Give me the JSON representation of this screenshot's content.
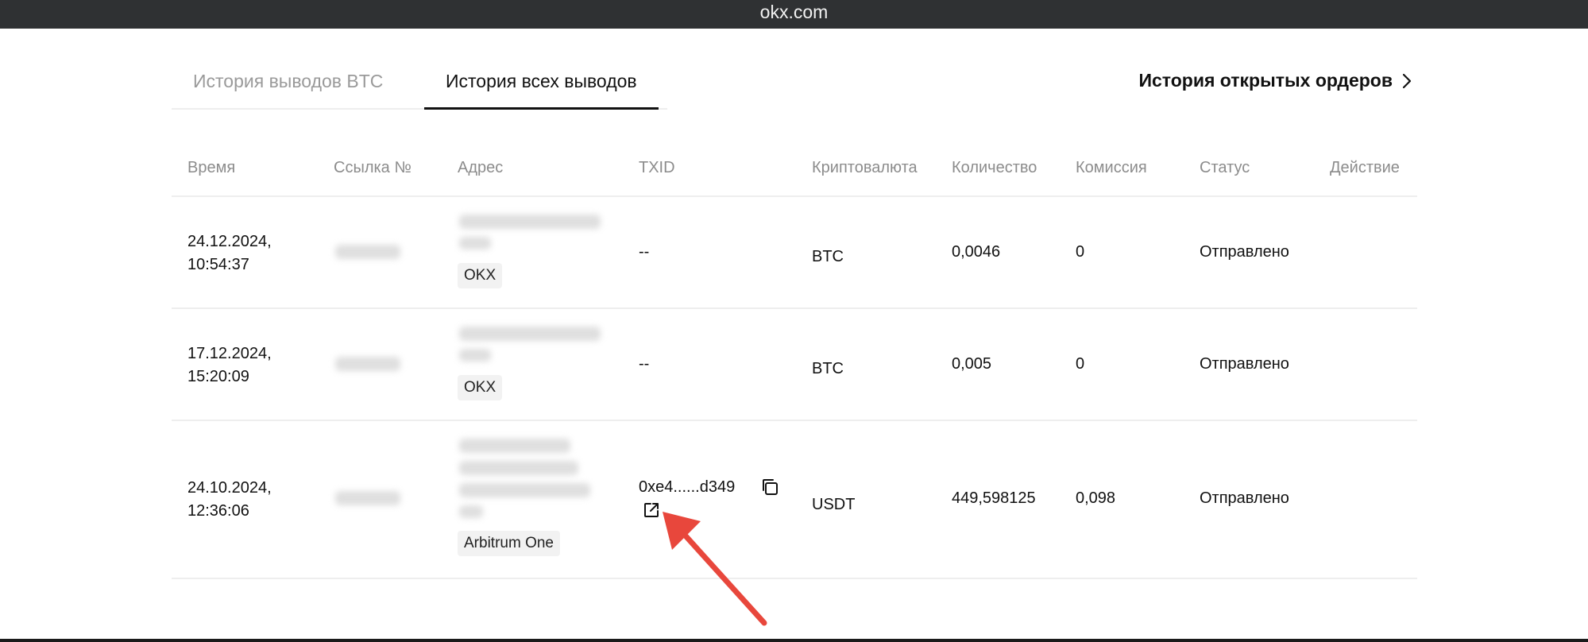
{
  "browser": {
    "domain": "okx.com"
  },
  "tabs": [
    {
      "label": "История выводов BTC",
      "active": false
    },
    {
      "label": "История всех выводов",
      "active": true
    }
  ],
  "open_orders_link": {
    "label": "История открытых ордеров"
  },
  "table": {
    "headers": [
      "Время",
      "Ссылка №",
      "Адрес",
      "TXID",
      "Криптовалюта",
      "Количество",
      "Комиссия",
      "Статус",
      "Действие"
    ],
    "rows": [
      {
        "date": "24.12.2024,",
        "time": "10:54:37",
        "reference": "",
        "address_network": "OKX",
        "txid": "--",
        "currency": "BTC",
        "amount": "0,0046",
        "fee": "0",
        "status": "Отправлено"
      },
      {
        "date": "17.12.2024,",
        "time": "15:20:09",
        "reference": "",
        "address_network": "OKX",
        "txid": "--",
        "currency": "BTC",
        "amount": "0,005",
        "fee": "0",
        "status": "Отправлено"
      },
      {
        "date": "24.10.2024,",
        "time": "12:36:06",
        "reference": "",
        "address_network": "Arbitrum One",
        "txid": "0xe4......d349",
        "currency": "USDT",
        "amount": "449,598125",
        "fee": "0,098",
        "status": "Отправлено"
      }
    ]
  },
  "icons": {
    "chevron": "chevron-right-icon",
    "copy": "copy-icon",
    "external_link": "external-link-icon",
    "annotation": "red-arrow"
  },
  "colors": {
    "annotation_arrow": "#e8473c",
    "topbar": "#2f3133"
  }
}
